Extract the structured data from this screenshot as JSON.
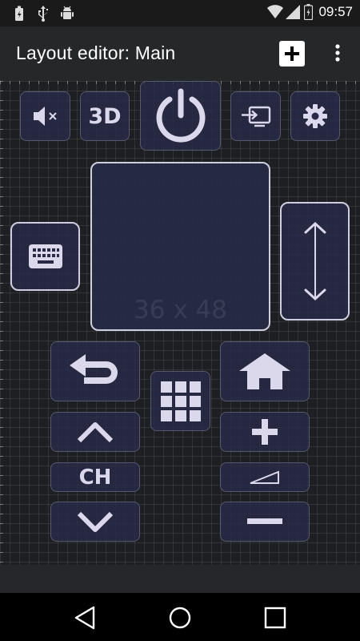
{
  "status_bar": {
    "time": "09:57",
    "left_icons": [
      "battery-saver-icon",
      "usb-icon",
      "android-debug-icon"
    ],
    "right_icons": [
      "wifi-icon",
      "signal-icon",
      "battery-icon"
    ]
  },
  "app_bar": {
    "title": "Layout editor: Main",
    "add_icon": "plus-icon",
    "menu_icon": "more-vert-icon"
  },
  "editor": {
    "buttons": {
      "mute_icon": "mute-icon",
      "three_d_label": "3D",
      "power_icon": "power-icon",
      "input_icon": "input-source-icon",
      "settings_icon": "gear-icon",
      "keyboard_icon": "keyboard-icon",
      "scroll_icon": "scroll-updown-icon",
      "back_icon": "back-icon",
      "home_icon": "home-icon",
      "apps_icon": "grid-icon",
      "channel_up_icon": "chevron-up-icon",
      "channel_label": "CH",
      "channel_down_icon": "chevron-down-icon",
      "volume_up_icon": "plus-icon",
      "volume_label_icon": "volume-wedge-icon",
      "volume_down_icon": "minus-icon"
    },
    "touchpad": {
      "size_label": "36 x 48"
    }
  },
  "nav_bar": {
    "back_icon": "nav-back-icon",
    "home_icon": "nav-home-icon",
    "recents_icon": "nav-recents-icon"
  },
  "colors": {
    "accent_border": "#cfcde0",
    "button_fill": "#282a48",
    "icon": "#dcd8ec"
  }
}
